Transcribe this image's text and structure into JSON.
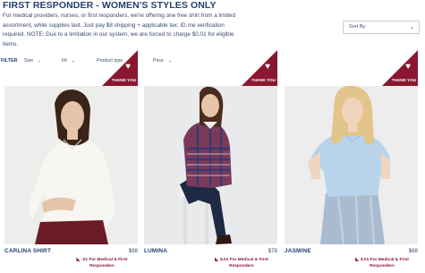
{
  "header": {
    "title": "FIRST RESPONDER - WOMEN'S STYLES ONLY",
    "description": "For medical providers, nurses, or first responders, we're offering one free shirt from a limited assortment, while supplies last. Just pay $8 shipping + applicable tax; ID.me verification required. NOTE: Due to a limitation in our system, we are forced to charge $0.01 for eligible items."
  },
  "sort": {
    "label": "Sort By",
    "icon": "chevron-down-icon"
  },
  "filters": {
    "label": "FILTER",
    "items": [
      {
        "label": "Size"
      },
      {
        "label": "Fit"
      },
      {
        "label": "Product type"
      },
      {
        "label": "Price"
      }
    ],
    "chevron": "⌄"
  },
  "colors": {
    "brand_navy": "#24406e",
    "badge_red": "#8a1730"
  },
  "products": [
    {
      "name": "CARLINA SHIRT",
      "price": "$98",
      "badge": "THANK YOU",
      "promo_line1": ".01 For Medical & First",
      "promo_line2": "Responders"
    },
    {
      "name": "LUMINA",
      "price": "$78",
      "badge": "THANK YOU",
      "promo_line1": "$.01 For Medical & First",
      "promo_line2": "Responders"
    },
    {
      "name": "JASMINE",
      "price": "$68",
      "badge": "THANK YOU",
      "promo_line1": "$.01 For Medical & First",
      "promo_line2": "Responders"
    }
  ]
}
